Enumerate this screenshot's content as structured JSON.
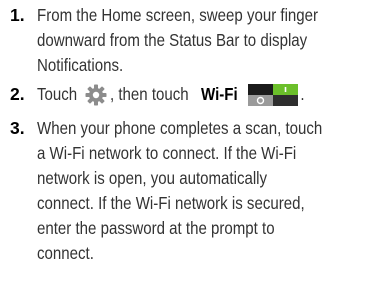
{
  "steps": [
    {
      "number": "1.",
      "lines": [
        "From the Home screen, sweep your finger",
        "downward from the Status Bar to display",
        "Notifications."
      ]
    },
    {
      "number": "2.",
      "text_before": "Touch",
      "gear_icon": "settings-gear-icon",
      "text_middle": ", then touch",
      "bold_label": "Wi-Fi",
      "toggle_icon": "wifi-toggle-on-icon",
      "text_after": "."
    },
    {
      "number": "3.",
      "lines": [
        "When your phone completes a scan, touch",
        "a Wi-Fi network to connect. If the Wi-Fi",
        "network is open, you automatically",
        "connect. If the Wi-Fi network is secured,",
        "enter the password at the prompt to",
        "connect."
      ]
    }
  ],
  "colors": {
    "text": "#333333",
    "number": "#000000",
    "toggle_green": "#6bbf2a",
    "toggle_dark": "#1b1b1b",
    "toggle_gray": "#9a9a9a",
    "gear": "#8c8c8c"
  }
}
